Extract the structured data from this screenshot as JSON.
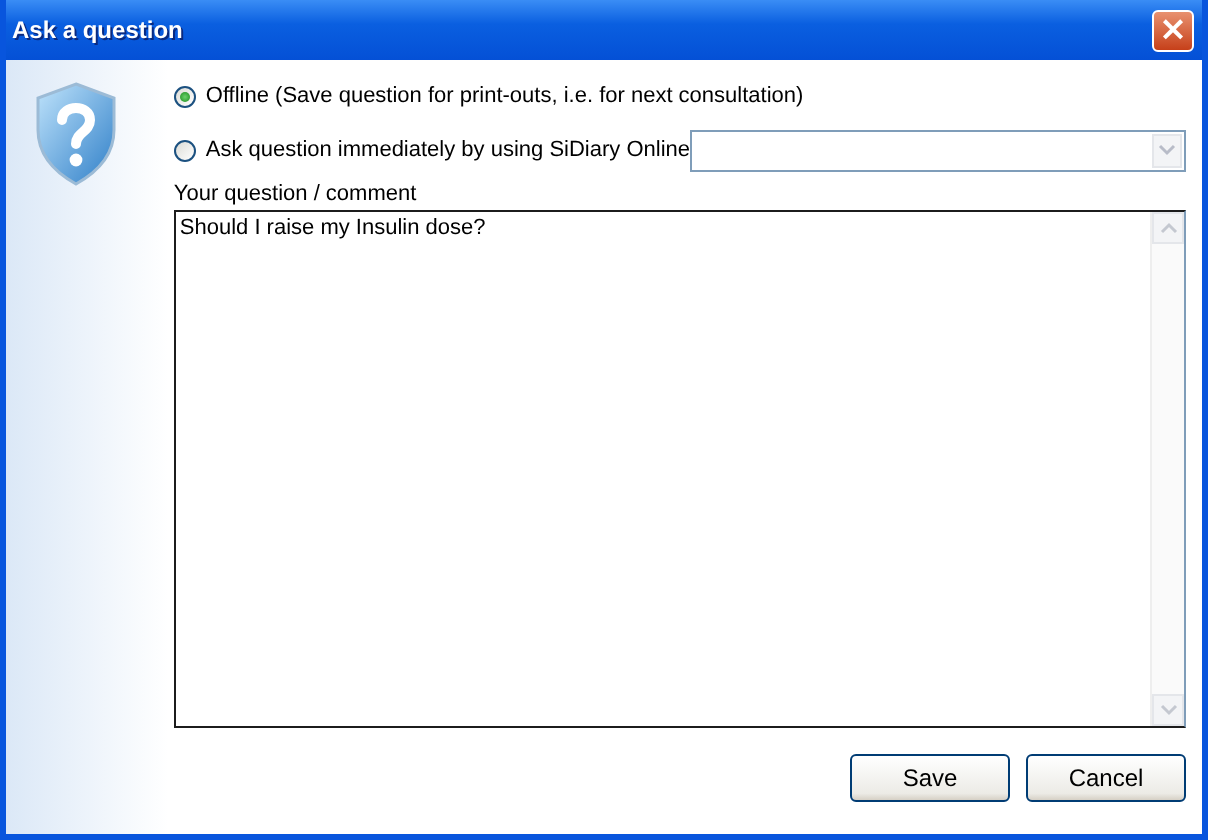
{
  "window": {
    "title": "Ask a question",
    "close": "×"
  },
  "options": [
    {
      "label": "Offline (Save question for print-outs, i.e. for next consultation)",
      "selected": true
    },
    {
      "label": "Ask question immediately by using SiDiary Online",
      "selected": false
    }
  ],
  "question": {
    "label": "Your question / comment",
    "value": "Should I raise my Insulin dose?"
  },
  "buttons": [
    "Save",
    "Cancel"
  ]
}
